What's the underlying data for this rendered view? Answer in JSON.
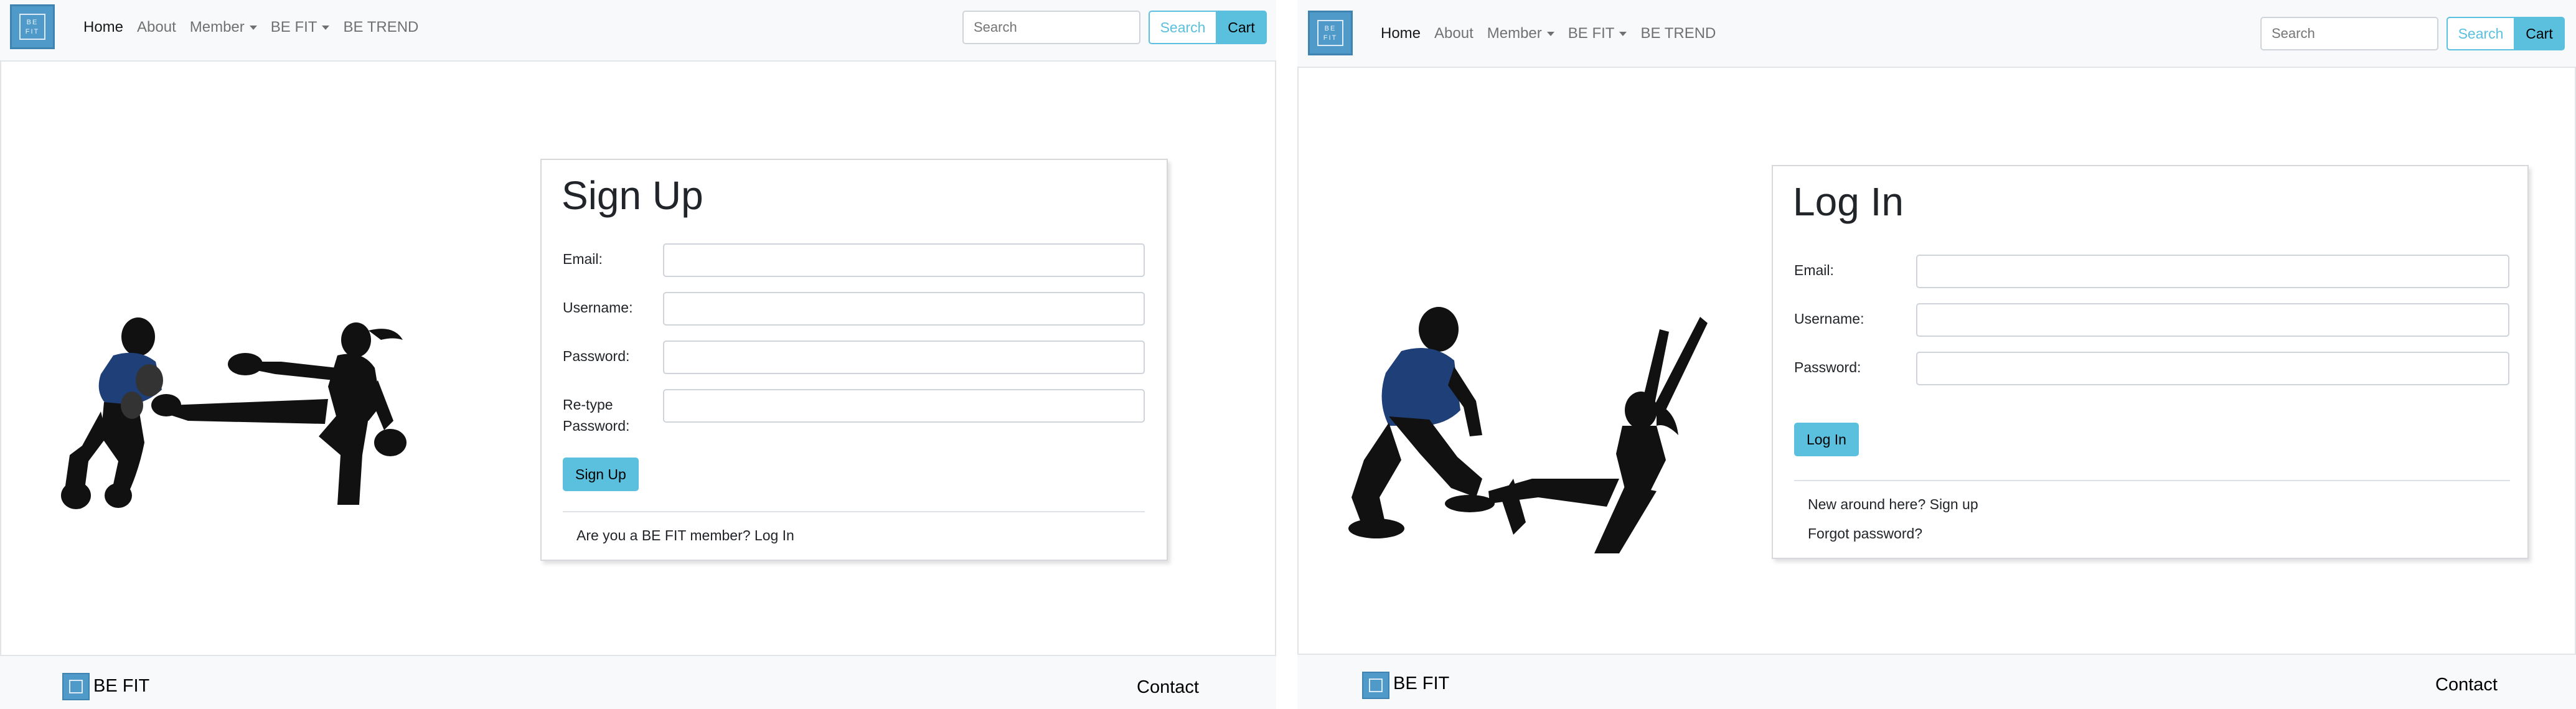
{
  "screens": [
    {
      "nav": {
        "logo_text": "BE FIT",
        "items": [
          "Home",
          "About",
          "Member",
          "BE FIT",
          "BE TREND"
        ],
        "search_placeholder": "Search",
        "search_button": "Search",
        "cart_button": "Cart"
      },
      "form": {
        "title": "Sign Up",
        "fields": [
          {
            "label": "Email:"
          },
          {
            "label": "Username:"
          },
          {
            "label": "Password:"
          },
          {
            "label_line1": "Re-type",
            "label_line2": "Password:"
          }
        ],
        "submit": "Sign Up",
        "links": [
          "Are you a BE FIT member? Log In"
        ]
      },
      "illustration": "kickboxing-silhouette",
      "footer": {
        "brand": "BE FIT",
        "contact": "Contact"
      }
    },
    {
      "nav": {
        "logo_text": "BE FIT",
        "items": [
          "Home",
          "About",
          "Member",
          "BE FIT",
          "BE TREND"
        ],
        "search_placeholder": "Search",
        "search_button": "Search",
        "cart_button": "Cart"
      },
      "form": {
        "title": "Log In",
        "fields": [
          {
            "label": "Email:"
          },
          {
            "label": "Username:"
          },
          {
            "label": "Password:"
          }
        ],
        "submit": "Log In",
        "links": [
          "New around here? Sign up",
          "Forgot password?"
        ]
      },
      "illustration": "partner-workout-silhouette",
      "footer": {
        "brand": "BE FIT",
        "contact": "Contact"
      }
    }
  ],
  "colors": {
    "accent": "#5bc0de",
    "logo": "#4f9ac9",
    "navbar_bg": "#f8f9fa"
  }
}
